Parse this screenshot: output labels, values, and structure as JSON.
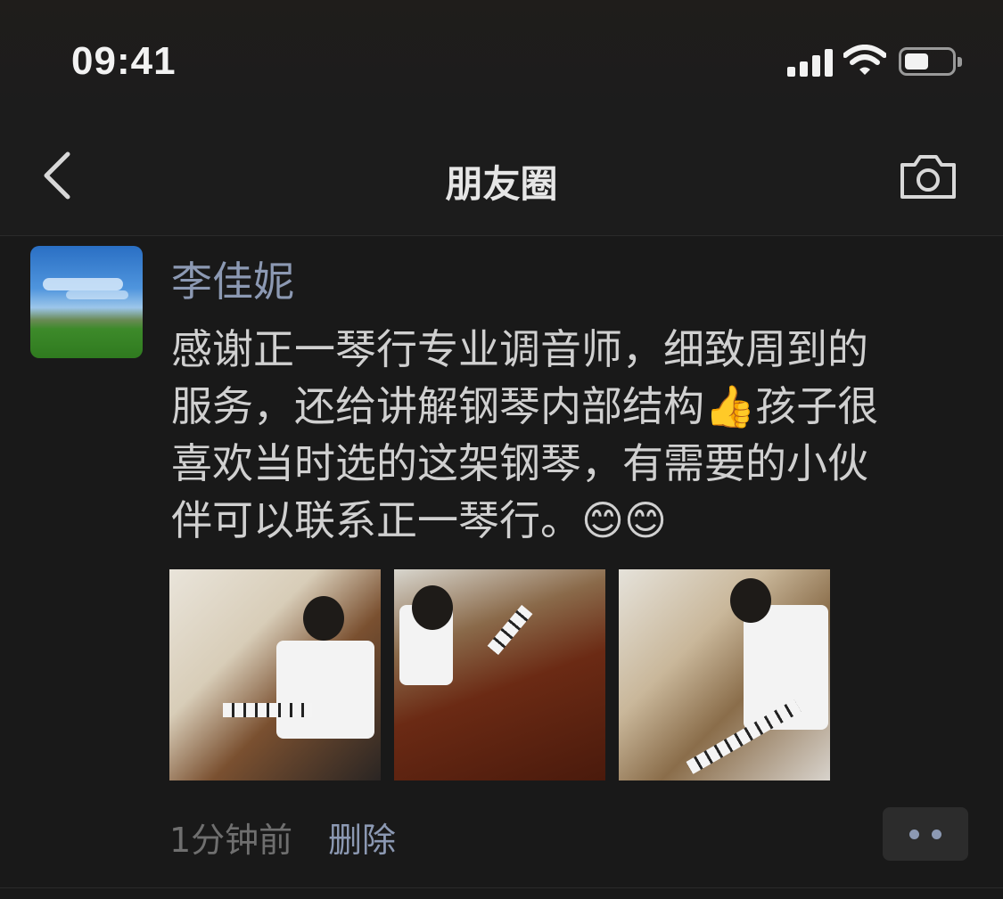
{
  "status_bar": {
    "time": "09:41"
  },
  "nav": {
    "title": "朋友圈"
  },
  "post": {
    "author": "李佳妮",
    "text_lines": [
      "感谢正一琴行专业调音师，细致周到的",
      "服务，还给讲解钢琴内部结构👍孩子很",
      "喜欢当时选的这架钢琴，有需要的小伙",
      "伴可以联系正一琴行。😊😊"
    ],
    "timestamp": "1分钟前",
    "delete_label": "删除"
  },
  "colors": {
    "background": "#191919",
    "link": "#8c99b3"
  }
}
